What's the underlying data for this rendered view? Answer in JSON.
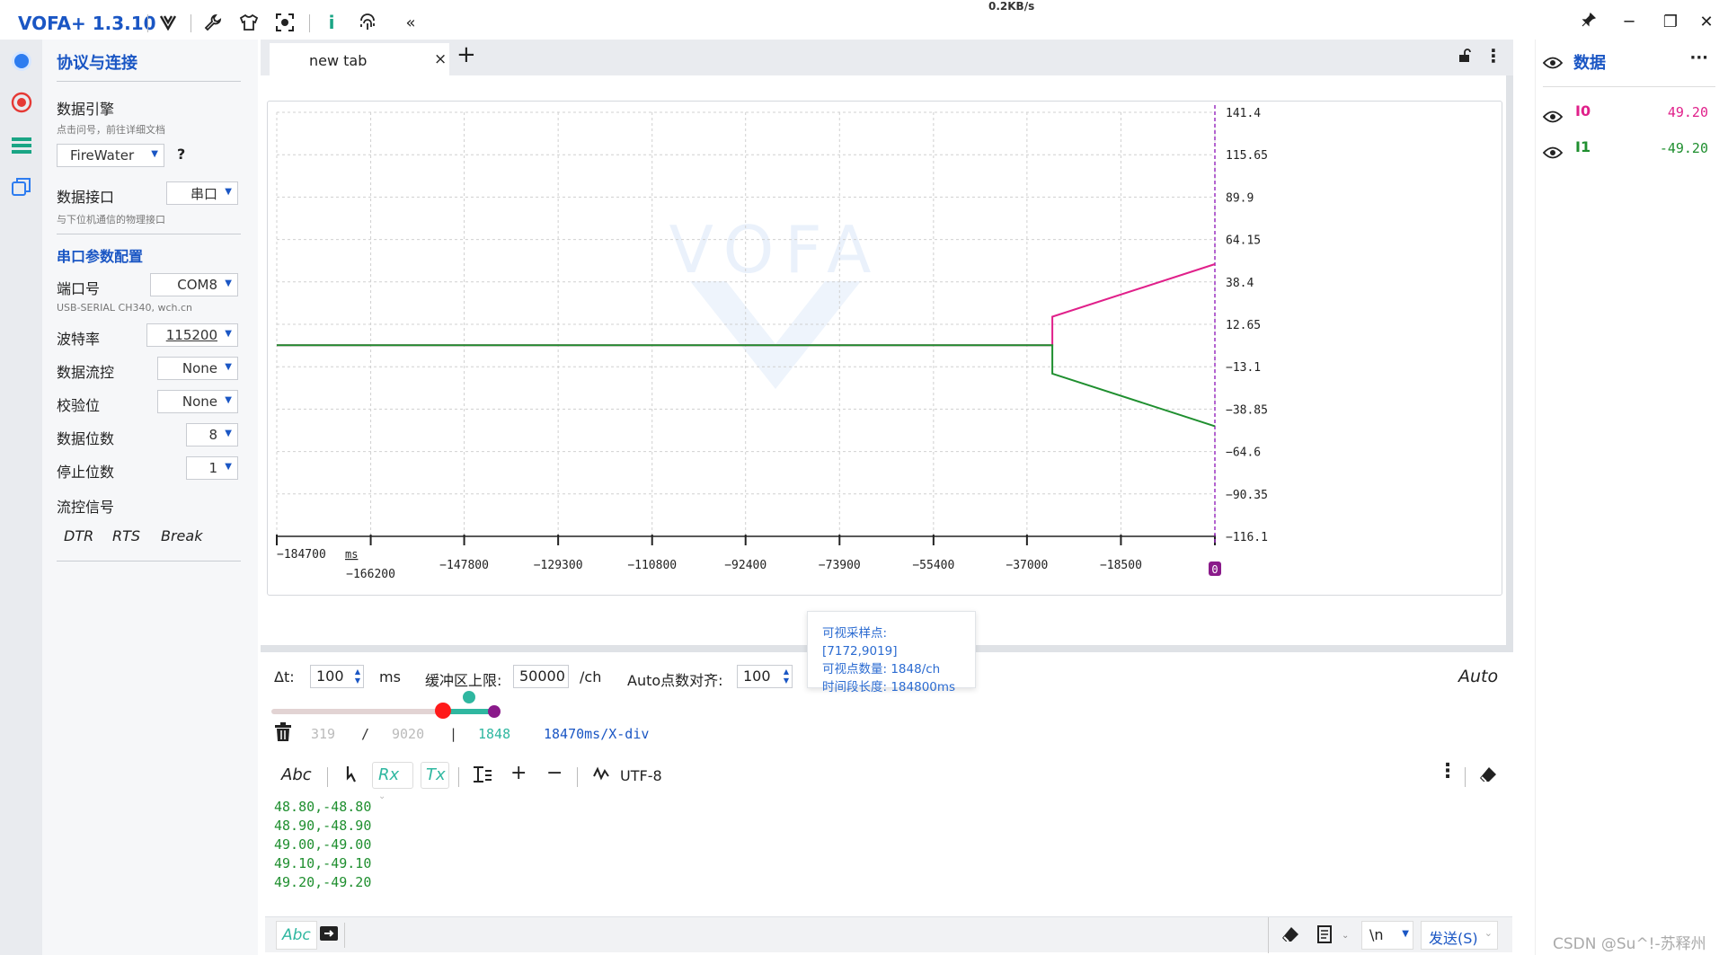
{
  "app": {
    "title": "VOFA+ 1.3.10"
  },
  "system": {
    "net_speed": "0.2KB/s"
  },
  "left_panel": {
    "title": "协议与连接",
    "engine_label": "数据引擎",
    "engine_hint": "点击问号，前往详细文档",
    "engine_value": "FireWater",
    "help": "?",
    "interface_label": "数据接口",
    "interface_value": "串口",
    "interface_hint": "与下位机通信的物理接口",
    "serial_section": "串口参数配置",
    "port_label": "端口号",
    "port_value": "COM8",
    "port_hint": "USB-SERIAL CH340, wch.cn",
    "baud_label": "波特率",
    "baud_value": "115200",
    "flow_label": "数据流控",
    "flow_value": "None",
    "parity_label": "校验位",
    "parity_value": "None",
    "databits_label": "数据位数",
    "databits_value": "8",
    "stopbits_label": "停止位数",
    "stopbits_value": "1",
    "flowsig_label": "流控信号",
    "flowsig_items": [
      "DTR",
      "RTS",
      "Break"
    ]
  },
  "tabs": [
    {
      "label": "new tab",
      "close": "×"
    }
  ],
  "tab_add": "+",
  "chart_data": {
    "type": "line",
    "watermark": "VOFA",
    "x_unit": "ms",
    "x_ticks": [
      -184700,
      -166200,
      -147800,
      -129300,
      -110800,
      -92400,
      -73900,
      -55400,
      -37000,
      -18500,
      0
    ],
    "y_ticks": [
      141.4,
      115.65,
      89.9,
      64.15,
      38.4,
      12.65,
      -13.1,
      -38.85,
      -64.6,
      -90.35,
      -116.1
    ],
    "ylim": [
      -116.1,
      141.4
    ],
    "xlim": [
      -184700,
      0
    ],
    "cursor_label": "0",
    "series": [
      {
        "name": "I0",
        "color": "#e0208a",
        "points": [
          [
            -184700,
            0
          ],
          [
            -32000,
            0
          ],
          [
            -32000,
            17.3
          ],
          [
            0,
            49.2
          ]
        ]
      },
      {
        "name": "I1",
        "color": "#1f8f2f",
        "points": [
          [
            -184700,
            0
          ],
          [
            -32000,
            0
          ],
          [
            -32000,
            -17.3
          ],
          [
            0,
            -49.2
          ]
        ]
      }
    ]
  },
  "controls": {
    "dt_label": "Δt:",
    "dt_value": "100",
    "dt_unit": "ms",
    "buffer_label": "缓冲区上限:",
    "buffer_value": "50000",
    "buffer_unit": "/ch",
    "align_label": "Auto点数对齐:",
    "align_value": "100",
    "auto": "Auto"
  },
  "tooltip": {
    "line1": "可视采样点: [7172,9019]",
    "line2": "可视点数量: 1848/ch",
    "line3": "时间段长度: 184800ms"
  },
  "stats": {
    "a": "319",
    "slash": "/",
    "b": "9020",
    "bar": "|",
    "c": "1848",
    "div": "18470ms/X-div"
  },
  "rx_toolbar": {
    "abc": "Abc",
    "rx": "Rx",
    "tx": "Tx",
    "encoding": "UTF-8"
  },
  "rx_lines": [
    "48.80,-48.80",
    "48.90,-48.90",
    "49.00,-49.00",
    "49.10,-49.10",
    "49.20,-49.20"
  ],
  "send_bar": {
    "abc": "Abc",
    "newline": "\\n",
    "send": "发送(S)"
  },
  "right_panel": {
    "title": "数据",
    "more": "···",
    "channels": [
      {
        "name": "I0",
        "value": "49.20",
        "color": "#e0208a"
      },
      {
        "name": "I1",
        "value": "-49.20",
        "color": "#1f8f2f"
      }
    ]
  },
  "watermark": "CSDN @Su^!-苏释州"
}
